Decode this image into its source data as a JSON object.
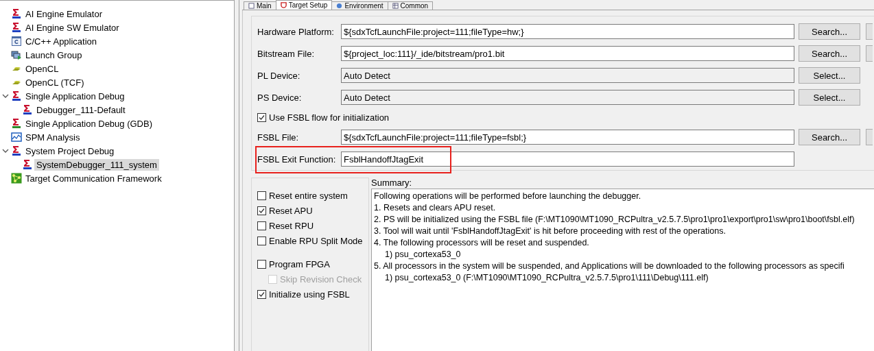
{
  "tree": [
    {
      "label": "AI Engine Emulator",
      "kind": "tcf",
      "selected": false
    },
    {
      "label": "AI Engine SW Emulator",
      "kind": "tcf",
      "selected": false
    },
    {
      "label": "C/C++ Application",
      "kind": "c-app",
      "selected": false
    },
    {
      "label": "Launch Group",
      "kind": "launch-group",
      "selected": false
    },
    {
      "label": "OpenCL",
      "kind": "opencl",
      "selected": false
    },
    {
      "label": "OpenCL (TCF)",
      "kind": "opencl",
      "selected": false
    },
    {
      "label": "Single Application Debug",
      "kind": "tcf",
      "selected": false,
      "expanded": true,
      "children": [
        {
          "label": "Debugger_111-Default",
          "kind": "tcf",
          "selected": false
        }
      ]
    },
    {
      "label": "Single Application Debug (GDB)",
      "kind": "gdb",
      "selected": false
    },
    {
      "label": "SPM Analysis",
      "kind": "spm",
      "selected": false
    },
    {
      "label": "System Project Debug",
      "kind": "tcf",
      "selected": false,
      "expanded": true,
      "children": [
        {
          "label": "SystemDebugger_111_system",
          "kind": "tcf",
          "selected": true
        }
      ]
    },
    {
      "label": "Target Communication Framework",
      "kind": "framework",
      "selected": false
    }
  ],
  "tabs": [
    {
      "label": "Main",
      "kind": "main",
      "selected": false
    },
    {
      "label": "Target Setup",
      "kind": "target",
      "selected": true
    },
    {
      "label": "Environment",
      "kind": "environment",
      "selected": false
    },
    {
      "label": "Common",
      "kind": "common",
      "selected": false
    }
  ],
  "rows": [
    {
      "kind": "field",
      "label": "Hardware Platform:",
      "value": "${sdxTcfLaunchFile:project=111;fileType=hw;}",
      "editable": true,
      "button": "Search...",
      "cut_button": true
    },
    {
      "kind": "field",
      "label": "Bitstream File:",
      "value": "${project_loc:111}/_ide/bitstream/pro1.bit",
      "editable": true,
      "button": "Search...",
      "cut_button": true
    },
    {
      "kind": "field",
      "label": "PL Device:",
      "value": "Auto Detect",
      "editable": false,
      "button": "Select..."
    },
    {
      "kind": "field",
      "label": "PS Device:",
      "value": "Auto Detect",
      "editable": false,
      "button": "Select..."
    },
    {
      "kind": "checkbox",
      "label": "Use FSBL flow for initialization",
      "checked": true
    },
    {
      "kind": "field",
      "label": "FSBL File:",
      "value": "${sdxTcfLaunchFile:project=111;fileType=fsbl;}",
      "editable": true,
      "button": "Search...",
      "cut_button": true
    },
    {
      "kind": "field",
      "label": "FSBL Exit Function:",
      "value": "FsblHandoffJtagExit",
      "editable": true,
      "highlighted": true
    }
  ],
  "options": [
    {
      "label": "Reset entire system",
      "checked": false
    },
    {
      "label": "Reset APU",
      "checked": true
    },
    {
      "label": "Reset RPU",
      "checked": false
    },
    {
      "label": "Enable RPU Split Mode",
      "checked": false
    },
    {
      "label": "Program FPGA",
      "checked": false,
      "separated": true,
      "children": [
        {
          "label": "Skip Revision Check",
          "checked": false,
          "disabled": true
        }
      ]
    },
    {
      "label": "Initialize using FSBL",
      "checked": true
    }
  ],
  "summary": {
    "title": "Summary:",
    "lines": [
      {
        "text": "Following operations will be performed before launching the debugger."
      },
      {
        "text": "1. Resets and clears APU reset."
      },
      {
        "text": "2. PS will be initialized using the FSBL file (F:\\MT1090\\MT1090_RCPultra_v2.5.7.5\\pro1\\pro1\\export\\pro1\\sw\\pro1\\boot\\fsbl.elf)"
      },
      {
        "text": "3. Tool will wait until 'FsblHandoffJtagExit' is hit before proceeding with rest of the operations."
      },
      {
        "text": "4. The following processors will be reset and suspended."
      },
      {
        "text": "1) psu_cortexa53_0",
        "indented": true
      },
      {
        "text": "5. All processors in the system will be suspended, and Applications will be downloaded to the following processors as specifi"
      },
      {
        "text": "1) psu_cortexa53_0 (F:\\MT1090\\MT1090_RCPultra_v2.5.7.5\\pro1\\111\\Debug\\111.elf)",
        "indented": true
      }
    ]
  }
}
